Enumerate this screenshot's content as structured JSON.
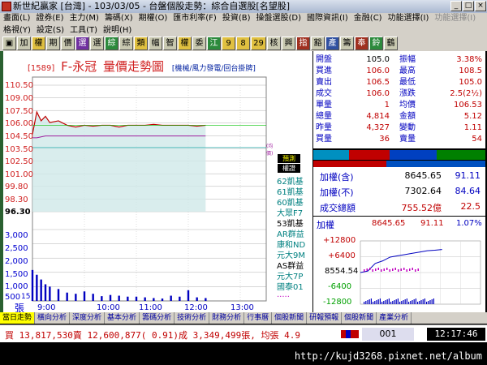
{
  "window": {
    "title": "新世紀贏家 [台灣] - 103/03/05 - 台盤個股走勢：綜合自選股[名望股]"
  },
  "menu": {
    "row1": [
      "畫面(L)",
      "證券(E)",
      "主力(M)",
      "籌碼(X)",
      "期權(O)",
      "匯市利率(F)",
      "投資(B)",
      "操盤選股(D)",
      "國際資訊(I)",
      "金融(C)",
      "功能選擇(I)",
      "功能選擇(I)"
    ],
    "row2": [
      "格視(Y)",
      "設定(S)",
      "工具(T)",
      "說明(H)"
    ]
  },
  "toolbar": {
    "buttons": [
      "▣",
      "加",
      "權",
      "期",
      "價",
      "選",
      "選",
      "綜",
      "綜",
      "類",
      "幅",
      "智",
      "權",
      "委",
      "江",
      "9",
      "8",
      "29",
      "核",
      "興",
      "指",
      "豁",
      "產",
      "籌",
      "奉",
      "鈴",
      "鶴"
    ]
  },
  "chart": {
    "code": "[1589]",
    "name": "F-永冠",
    "title": "量價走勢圖",
    "subtitle": "[機械/風力發電/回台掛牌]",
    "price_ticks": [
      "110.50",
      "109.00",
      "107.50",
      "106.00",
      "104.50",
      "103.50",
      "102.50",
      "101.00",
      "99.80",
      "98.30",
      "96.30"
    ],
    "volume_ticks": [
      "3,000",
      "2,500",
      "2,000",
      "1,500",
      "1,000",
      "500",
      "15"
    ],
    "volume_unit": "張",
    "time_ticks": [
      "9:00",
      "10:00",
      "11:00",
      "12:00",
      "13:00"
    ],
    "ref_marker": "(均價)"
  },
  "chart_data": {
    "type": "line",
    "title": "量價走勢圖",
    "xlabel": "",
    "ylabel": "",
    "x": [
      "9:00",
      "9:05",
      "9:10",
      "9:15",
      "9:20",
      "9:30",
      "9:40",
      "9:50",
      "10:00",
      "10:10",
      "10:20",
      "10:30",
      "10:40",
      "10:50",
      "11:00",
      "11:10",
      "11:20",
      "11:30",
      "11:40",
      "11:50",
      "12:00",
      "12:10",
      "12:20"
    ],
    "series": [
      {
        "values": [
          105.0,
          107.5,
          106.5,
          107.0,
          106.3,
          106.5,
          106.0,
          105.8,
          106.0,
          105.9,
          106.0,
          106.0,
          105.8,
          106.0,
          106.0,
          106.0,
          106.1,
          106.0,
          106.0,
          106.0,
          106.0,
          105.9,
          106.0
        ]
      },
      {
        "values": [
          104.6,
          104.6,
          104.7,
          104.8,
          104.8,
          104.8,
          104.8,
          104.8,
          104.8,
          104.8,
          104.8,
          104.8,
          104.8,
          104.8,
          104.8,
          104.8,
          104.8,
          104.8,
          104.8,
          104.8,
          104.8,
          104.8,
          104.8
        ]
      }
    ],
    "volumes": [
      1300,
      1100,
      900,
      700,
      600,
      500,
      350,
      300,
      400,
      300,
      200,
      250,
      220,
      180,
      180,
      150,
      120,
      100,
      220,
      180,
      450,
      150,
      120
    ],
    "ylim": [
      96.3,
      110.5
    ],
    "vol_ylim": [
      0,
      3000
    ]
  },
  "quote": {
    "rows": [
      [
        "開盤",
        "105.0",
        "振幅",
        "3.38%"
      ],
      [
        "買進",
        "106.0",
        "最高",
        "108.5"
      ],
      [
        "賣出",
        "106.5",
        "最低",
        "105.0"
      ],
      [
        "成交",
        "106.0",
        "漲跌",
        "2.5(2½)"
      ],
      [
        "單量",
        "1",
        "均價",
        "106.53"
      ],
      [
        "總量",
        "4,814",
        "金額",
        "5.12"
      ],
      [
        "昨量",
        "4,327",
        "變動",
        "1.11"
      ],
      [
        "買量",
        "36",
        "賣量",
        "54"
      ]
    ]
  },
  "broker_list": {
    "tag1": "預測",
    "tag2": "權證",
    "items": [
      "62凱基",
      "61凱基",
      "60凱基",
      "大眾F7",
      "53凱基",
      "AR群益",
      "康和ND",
      "元大9M",
      "AS群益",
      "元大7P",
      "國泰01",
      "....."
    ]
  },
  "index": {
    "rows": [
      {
        "label": "加權(含)",
        "value": "8645.65",
        "pct": "91.11"
      },
      {
        "label": "加權(不)",
        "value": "7302.64",
        "pct": "84.64"
      },
      {
        "label": "成交總額",
        "value": "755.52億",
        "pct": "22.5"
      }
    ],
    "mini_title": "加權",
    "mini_value": "8645.65",
    "mini_change": "91.11",
    "mini_pct": "1.07%",
    "mini_ticks": [
      "+12800",
      "+6400",
      "8554.54",
      "-6400",
      "-12800"
    ]
  },
  "mini_chart_data": {
    "type": "line",
    "series": [
      {
        "values": [
          8554,
          8560,
          8590,
          8600,
          8615,
          8620,
          8625,
          8630,
          8635,
          8640,
          8642,
          8645
        ]
      }
    ]
  },
  "tabs": [
    "當日走勢",
    "橫向分析",
    "深度分析",
    "基本分析",
    "籌碼分析",
    "技術分析",
    "財務分析",
    "行事曆",
    "個股新聞",
    "研報預報",
    "個股新聞",
    "產業分析"
  ],
  "status": {
    "text": "買 13,817,530賣 12,600,877( 0.91)成 3,349,499張, 均張 4.9",
    "code": "001",
    "clock": "12:17:46"
  },
  "watermark": "http://kujd3268.pixnet.net/album",
  "colors": {
    "price_line": "#c00000",
    "avg_line": "#a020a0",
    "volume": "#0000c0",
    "fill": "#cfe8e8"
  }
}
